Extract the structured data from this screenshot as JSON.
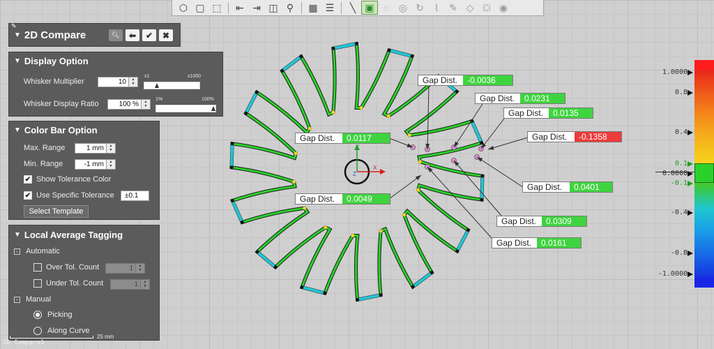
{
  "app": {
    "statusbar": "2D Compare1",
    "scale_label": "25 mm"
  },
  "toolbar": {
    "icons": [
      "view-cube-icon",
      "box-icon",
      "iso-view-icon",
      "align-left-icon",
      "align-right-icon",
      "split-view-icon",
      "person-view-icon",
      "grid-layout-icon",
      "list-view-icon",
      "line-tool-icon",
      "select-box-icon",
      "radial-select-icon",
      "circle-select-icon",
      "rotate-select-icon",
      "lasso-icon",
      "edit-select-icon",
      "polygon-select-icon",
      "paint-icon",
      "eye-icon"
    ]
  },
  "main_panel": {
    "title": "2D Compare",
    "buttons": [
      "search-icon",
      "back-arrow-icon",
      "check-icon",
      "close-icon"
    ]
  },
  "display_option": {
    "title": "Display Option",
    "whisker_multiplier_label": "Whisker Multiplier",
    "whisker_multiplier_value": "10",
    "whisker_slider_min": "x1",
    "whisker_slider_max": "x1000",
    "whisker_slider_level": 0.2,
    "whisker_ratio_label": "Whisker Display Ratio",
    "whisker_ratio_value": "100 %",
    "ratio_slider_min": "1%",
    "ratio_slider_max": "100%",
    "ratio_slider_level": 1.0
  },
  "color_bar_option": {
    "title": "Color Bar Option",
    "max_range_label": "Max. Range",
    "max_range_value": "1 mm",
    "min_range_label": "Min. Range",
    "min_range_value": "-1 mm",
    "show_tol_label": "Show Tolerance Color",
    "show_tol_checked": true,
    "use_tol_label": "Use Specific Tolerance",
    "use_tol_checked": true,
    "tol_value": "±0.1",
    "select_template": "Select Template"
  },
  "local_avg": {
    "title": "Local Average Tagging",
    "automatic_label": "Automatic",
    "over_tol_label": "Over Tol. Count",
    "over_tol_value": "1",
    "under_tol_label": "Under Tol. Count",
    "under_tol_value": "1",
    "manual_label": "Manual",
    "picking_label": "Picking",
    "along_curve_label": "Along Curve",
    "selected_mode": "Picking"
  },
  "callouts": [
    {
      "label": "Gap Dist.",
      "value": "-0.0036",
      "color": "#3fd43f"
    },
    {
      "label": "Gap Dist.",
      "value": "0.0231",
      "color": "#3fd43f"
    },
    {
      "label": "Gap Dist.",
      "value": "0.0135",
      "color": "#3fd43f"
    },
    {
      "label": "Gap Dist.",
      "value": "0.0117",
      "color": "#3fd43f"
    },
    {
      "label": "Gap Dist.",
      "value": "-0.1358",
      "color": "#ee3b3b"
    },
    {
      "label": "Gap Dist.",
      "value": "0.0401",
      "color": "#3fd43f"
    },
    {
      "label": "Gap Dist.",
      "value": "0.0049",
      "color": "#3fd43f"
    },
    {
      "label": "Gap Dist.",
      "value": "0.0309",
      "color": "#3fd43f"
    },
    {
      "label": "Gap Dist.",
      "value": "0.0161",
      "color": "#3fd43f"
    }
  ],
  "color_bar": {
    "labels": [
      "1.0000",
      "0.8",
      "0.4",
      "0.1",
      "0.0000",
      "-0.1",
      "-0.4",
      "-0.8",
      "-1.0000"
    ],
    "colors": [
      "#e8261a",
      "#ef5a19",
      "#f58a1a",
      "#f6b21d",
      "#f7d21c",
      "#3ec832",
      "#1fc7cf",
      "#1a9be8",
      "#1769e6",
      "#1531e0"
    ],
    "over_color": "#ff1c1c",
    "under_color": "#1a26e6",
    "tolerance_color": "#2bd12b"
  },
  "axis": {
    "x": "X",
    "y": "Y",
    "z": "Z"
  }
}
